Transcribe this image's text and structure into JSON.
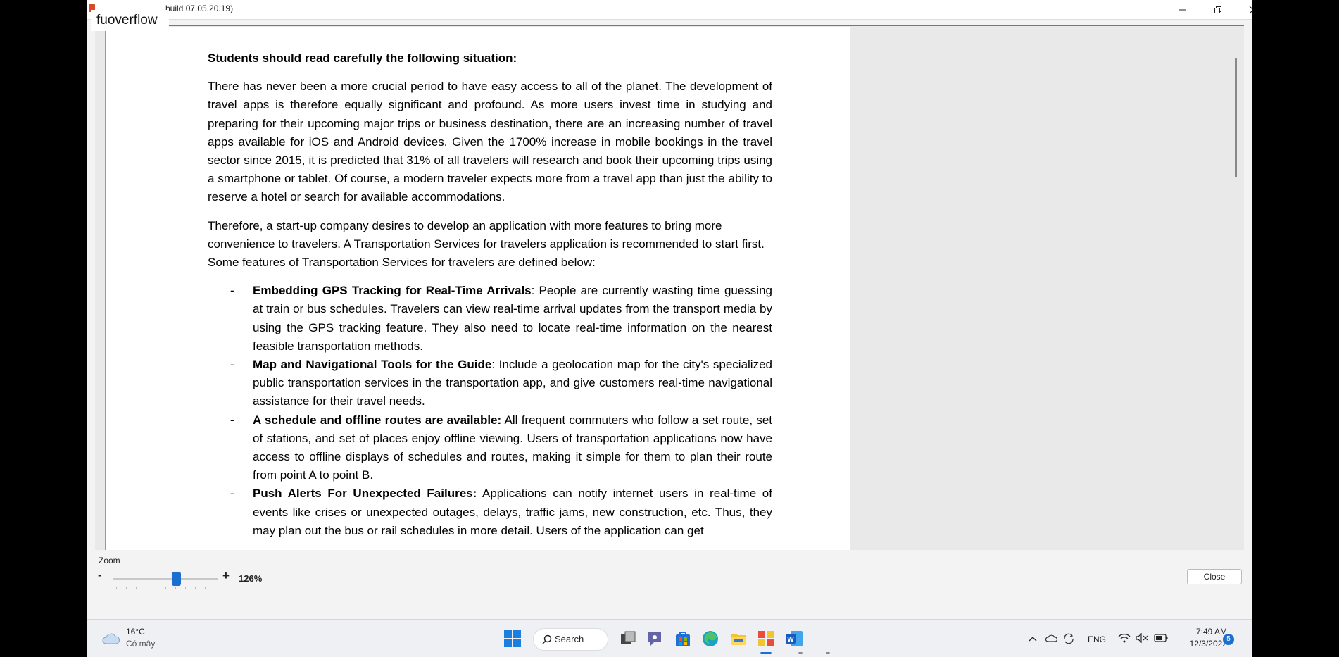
{
  "window": {
    "title": "build 07.05.20.19)",
    "watermark": "fuoverflow"
  },
  "document": {
    "heading": "Students should read carefully the following situation:",
    "paragraph1": "There has never been a more crucial period to have easy access to all of the planet. The development of travel apps is therefore equally significant and profound. As more users invest time in studying and preparing for their upcoming major trips or business destination, there are an increasing number of travel apps available for iOS and Android devices. Given the 1700% increase in mobile bookings in the travel sector since 2015, it is predicted that 31% of all travelers will research and book their upcoming trips using a smartphone or tablet. Of course, a modern traveler expects more from a travel app than just the ability to reserve a hotel or search for available accommodations.",
    "paragraph2": "Therefore, a start-up company desires to develop an application with more features to bring more convenience to travelers. A Transportation Services for travelers application is recommended to start first. Some features of Transportation Services  for travelers are defined below:",
    "bullet_marker": "-",
    "features": [
      {
        "title": "Embedding GPS Tracking for Real-Time Arrivals",
        "text": ": People are currently wasting time guessing at train or bus schedules. Travelers can view real-time arrival updates from the transport media by using the GPS tracking feature. They also need to locate real-time information on the nearest feasible transportation methods."
      },
      {
        "title": "Map and Navigational Tools for the Guide",
        "text": ": Include a geolocation map for the city's specialized public transportation services in the transportation app, and give customers real-time navigational assistance for their travel needs."
      },
      {
        "title": "A schedule and offline routes are available:",
        "text": " All frequent commuters who follow a set route, set of stations, and set of places enjoy offline viewing. Users of transportation applications now have access to offline displays of schedules and routes, making it simple for them to plan their route from point A to point B."
      },
      {
        "title": "Push Alerts For Unexpected Failures:",
        "text": " Applications can notify internet users in real-time of events like crises or unexpected outages, delays, traffic jams, new construction, etc. Thus, they may plan out the bus or rail schedules in more detail. Users of the application can get"
      }
    ]
  },
  "zoom": {
    "label": "Zoom",
    "minus": "-",
    "plus": "+",
    "value": "126%",
    "level_fraction": 0.6
  },
  "close_label": "Close",
  "taskbar": {
    "weather_temp": "16°C",
    "weather_desc": "Có mây",
    "search_label": "Search",
    "lang": "ENG",
    "time": "7:49 AM",
    "date": "12/3/2022",
    "notification_count": "5"
  },
  "colors": {
    "accent": "#1a6fd1",
    "word_blue": "#185abd",
    "folder_yellow": "#f4c430"
  },
  "icons": {
    "app": "app-icon",
    "minimize": "minimize-icon",
    "restore": "restore-icon",
    "close": "close-icon",
    "weather": "cloud-icon",
    "start": "windows-start-icon",
    "search": "search-icon",
    "task_view": "task-view-icon",
    "chat": "teams-chat-icon",
    "store": "store-icon",
    "edge": "edge-icon",
    "explorer": "file-explorer-icon",
    "exam_app": "exam-app-icon",
    "word": "word-icon",
    "chevron": "chevron-up-icon",
    "onedrive": "onedrive-icon",
    "sync": "sync-icon",
    "wifi": "wifi-icon",
    "volume": "volume-muted-icon",
    "battery": "battery-icon"
  }
}
